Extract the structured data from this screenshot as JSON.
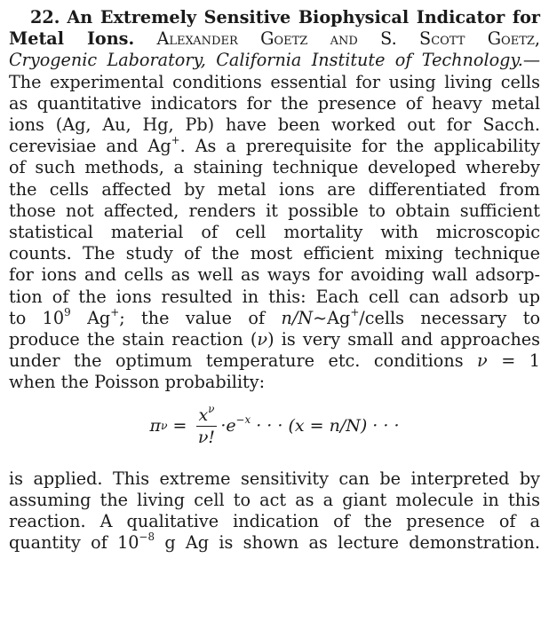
{
  "article": {
    "number": "22.",
    "title_part1": "An Extremely Sensitive Biophysical Indicator for",
    "title_part2": "Metal Ions.",
    "authors": "Alexander Goetz and S. Scott Goetz,",
    "affiliation": "Cryogenic Laboratory, California Institute of Technology.",
    "affiliation_dash": "—",
    "lines_1": [
      "The experimental conditions essential for using living cells",
      "as quantitative indicators for the presence of heavy metal",
      "ions (Ag, Au, Hg, Pb) have been worked out for Sacch."
    ],
    "line_ag": {
      "pre": "cerevisiae and Ag",
      "sup": "+",
      "post": ". As a prerequisite for the applicability"
    },
    "lines_2": [
      "of such methods, a staining technique developed whereby",
      "the cells affected by metal ions are differentiated from",
      "those not affected, renders it possible to obtain sufficient",
      "statistical material of cell mortality with microscopic",
      "counts. The study of the most efficient mixing technique",
      "for ions and cells as well as ways for avoiding wall adsorp-",
      "tion of the ions resulted in this: Each cell can adsorb up"
    ],
    "line_10_9": {
      "pre": "to 10",
      "sup1": "9",
      "mid1": " Ag",
      "sup2": "+",
      "mid2": "; the value of ",
      "ratio": "n/N",
      "mid3": "∼Ag",
      "sup3": "+",
      "post": "/cells necessary to"
    },
    "line_stain": {
      "pre": "produce the stain reaction (",
      "nu": "ν",
      "post": ") is very small and approaches"
    },
    "line_optimum": {
      "pre": "under the optimum temperature etc. conditions ",
      "nu": "ν",
      "post": " = 1"
    },
    "line_poisson": "when the Poisson probability:",
    "formula": {
      "lhs": "π",
      "lhs_sub": "ν",
      "eq": " = ",
      "num": "x",
      "num_sup": "ν",
      "den": "ν!",
      "exp_base": "·e",
      "exp_sup": "−x",
      "tail": " · · · (x = n/N) · · ·"
    },
    "lines_3": [
      "is applied. This extreme sensitivity can be interpreted by",
      "assuming the living cell to act as a giant molecule in this",
      "reaction. A qualitative indication of the presence of a"
    ],
    "line_last": {
      "pre": "quantity of 10",
      "sup": "−8",
      "post": " g Ag is shown as lecture demonstration."
    }
  }
}
